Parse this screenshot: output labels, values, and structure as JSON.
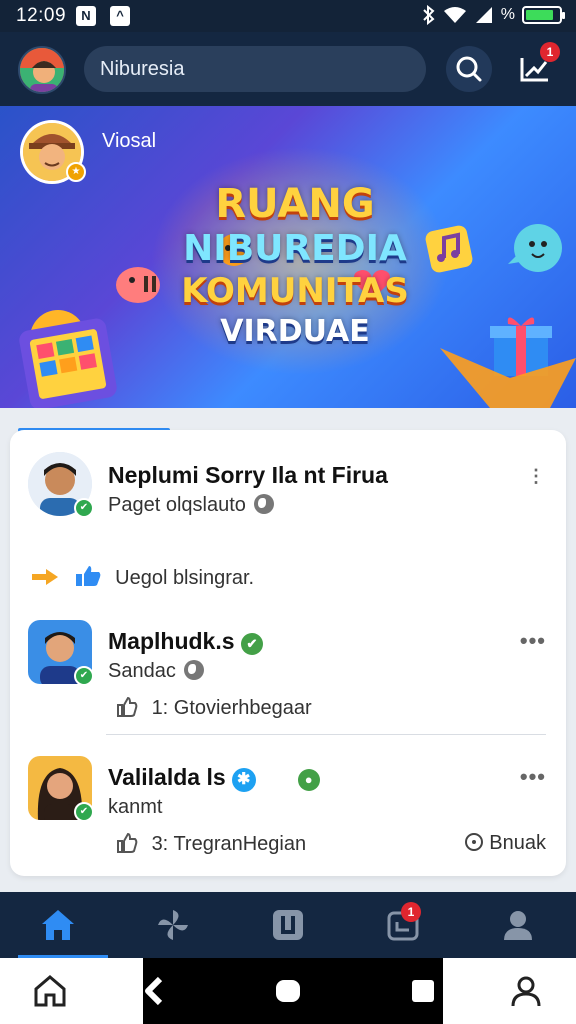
{
  "status_bar": {
    "time": "12:09",
    "network_label": "%",
    "battery_level": 0.85
  },
  "top_bar": {
    "search_value": "Niburesia",
    "notification_count": "1"
  },
  "banner": {
    "username": "Viosal",
    "title_line1": "RUANG",
    "title_line2": "NIBUREDIA",
    "title_line3": "KOMUNITAS",
    "title_line4": "VIRDUAE"
  },
  "feed": {
    "posts": [
      {
        "name": "Neplumi Sorry Ila nt Firua",
        "subtitle": "Paget olqslauto",
        "reaction_text": "Uegol blsingrar."
      },
      {
        "name": "Maplhudk.s",
        "subtitle": "Sandac",
        "stat_text": "1: Gtovierhbegaar"
      },
      {
        "name": "Valilalda ls",
        "subtitle": "kanmt",
        "stat_text": "3: TregranHegian",
        "action_label": "Bnuak"
      }
    ]
  },
  "bottom_nav": {
    "active_index": 0,
    "notification_count": "1"
  },
  "colors": {
    "app_bar": "#142741",
    "accent": "#2f8cf3",
    "badge_red": "#e0262f",
    "verified_green": "#2fa84f"
  }
}
